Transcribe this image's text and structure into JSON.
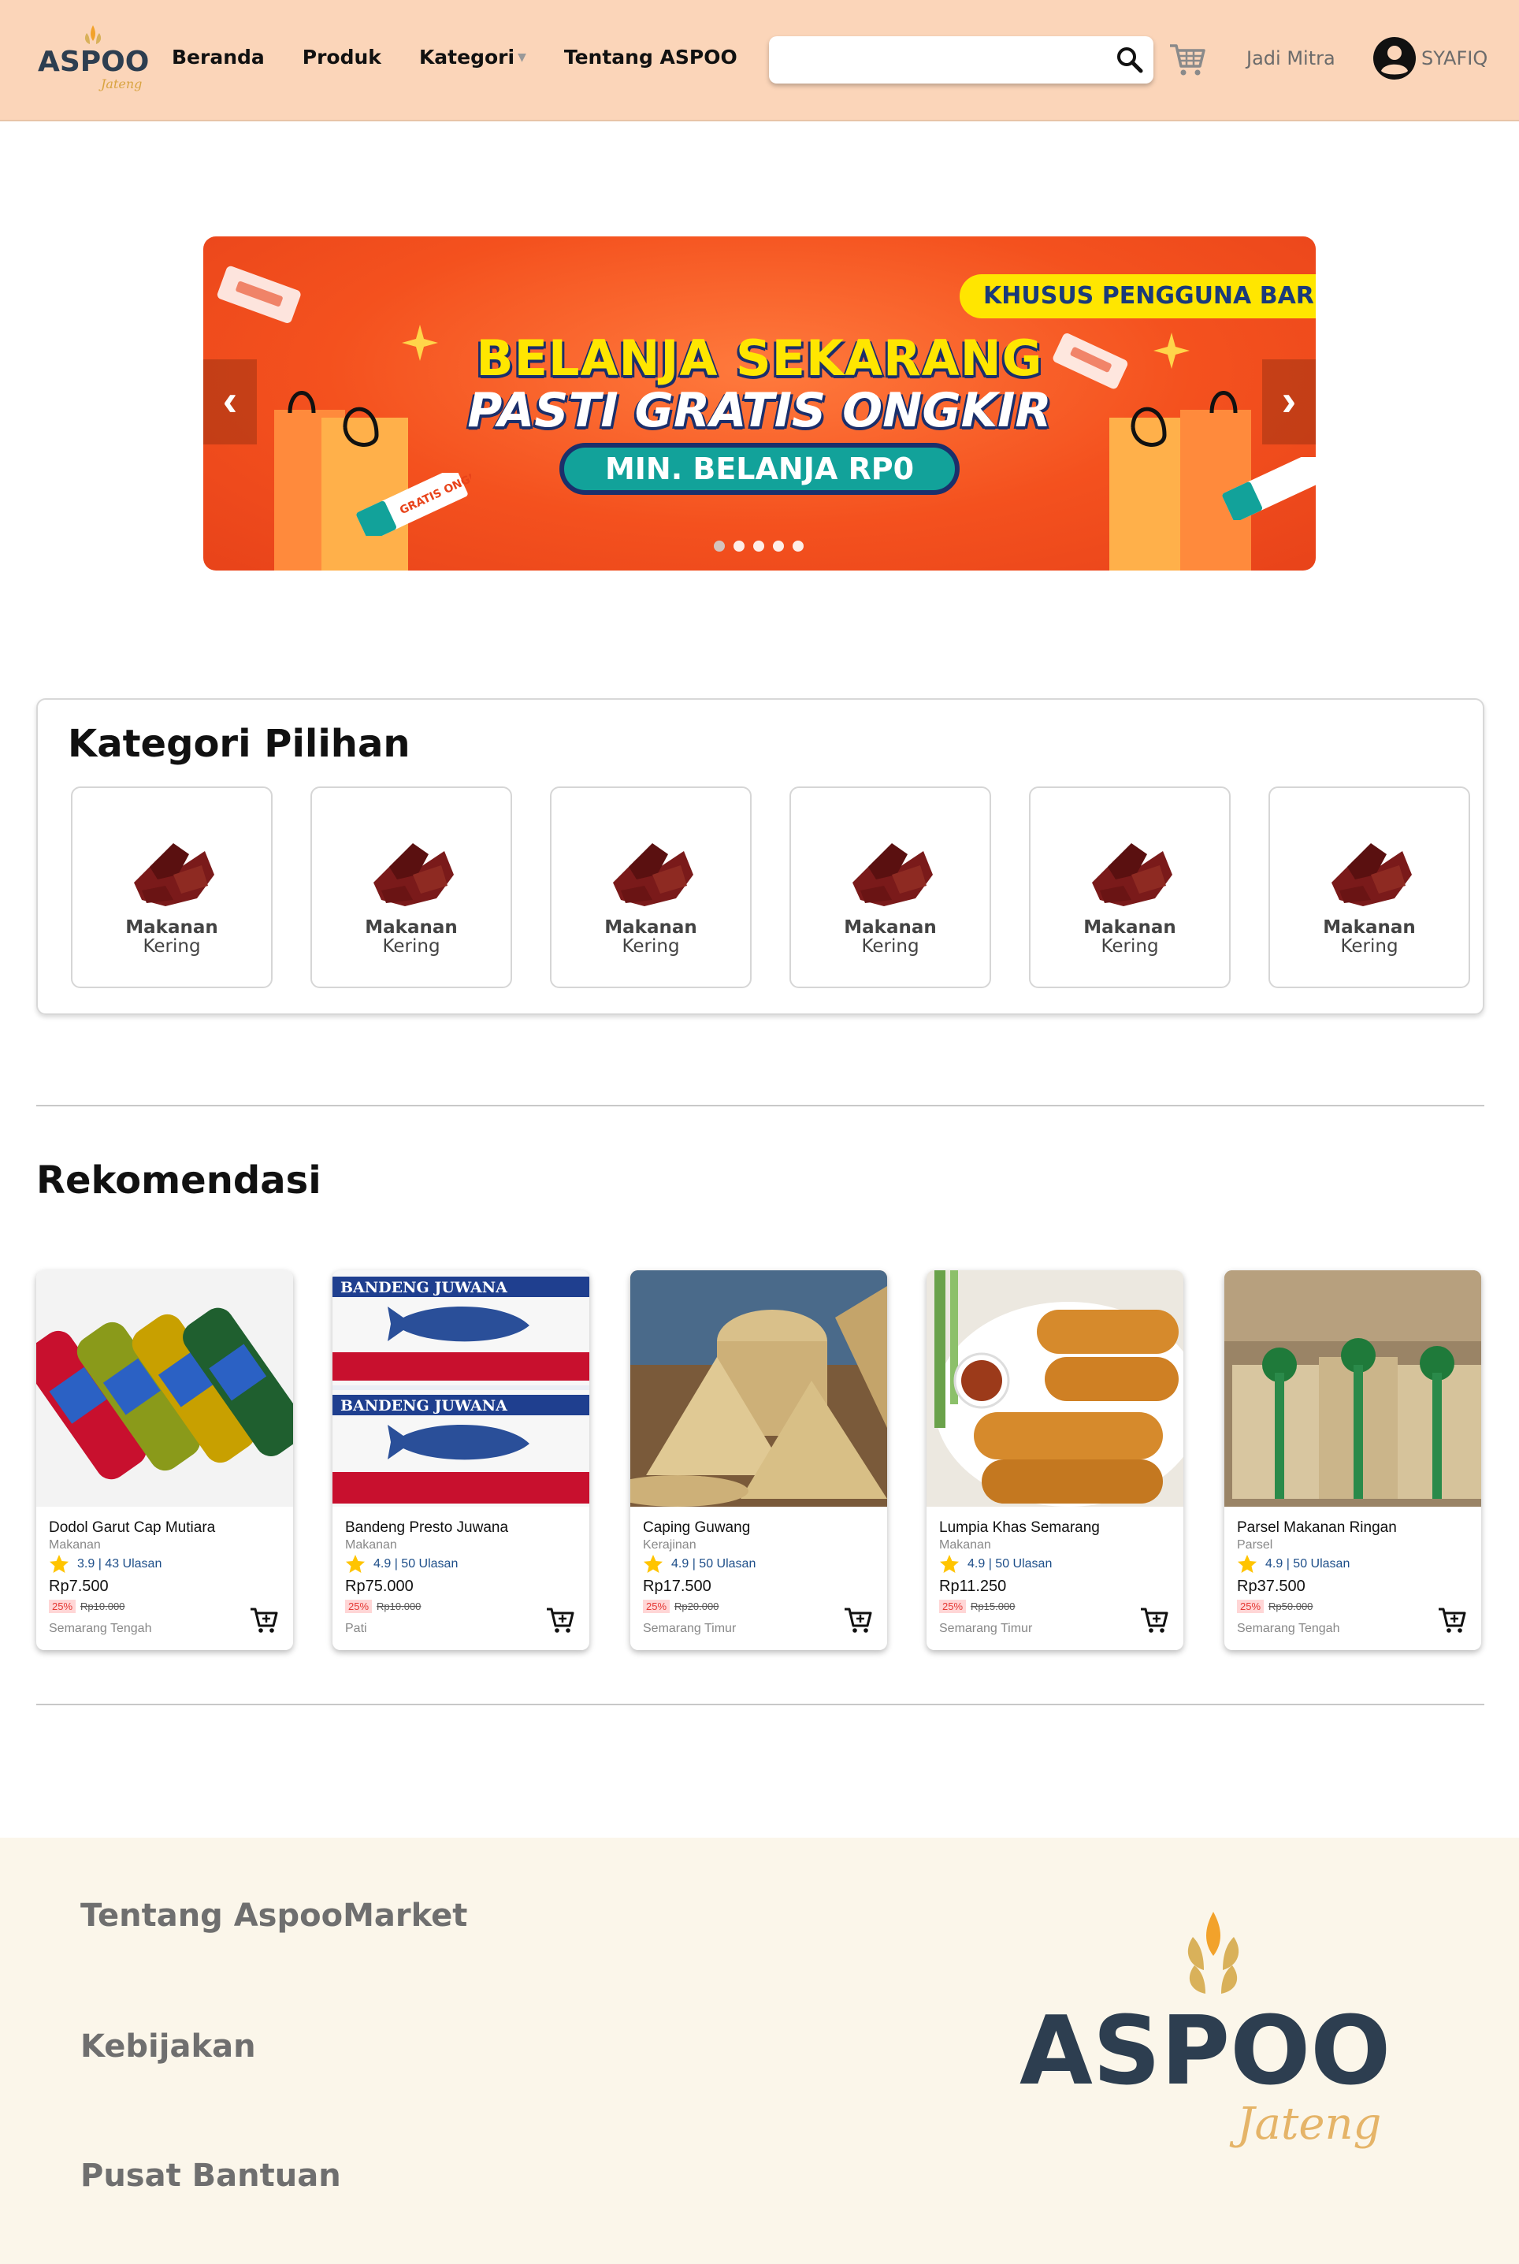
{
  "header": {
    "logo_text": "ASPOO",
    "logo_sub": "Jateng",
    "nav": [
      {
        "label": "Beranda"
      },
      {
        "label": "Produk"
      },
      {
        "label": "Kategori"
      },
      {
        "label": "Tentang ASPOO"
      }
    ],
    "search_placeholder": "",
    "mitra_label": "Jadi Mitra",
    "user_name": "SYAFIQ"
  },
  "banner": {
    "tag": "KHUSUS PENGGUNA BARU",
    "line1": "BELANJA SEKARANG",
    "line2": "PASTI GRATIS ONGKIR",
    "pill": "MIN. BELANJA RP0",
    "sticker": "GRATIS ONGKIR",
    "prev": "‹",
    "next": "›",
    "slides": 5,
    "active_slide": 0,
    "colors": {
      "bg": "#f4511e",
      "yellow": "#ffe600",
      "navy": "#1b2f6b",
      "teal": "#12a29a"
    }
  },
  "kategori": {
    "title": "Kategori Pilihan",
    "items": [
      {
        "line1": "Makanan",
        "line2": "Kering"
      },
      {
        "line1": "Makanan",
        "line2": "Kering"
      },
      {
        "line1": "Makanan",
        "line2": "Kering"
      },
      {
        "line1": "Makanan",
        "line2": "Kering"
      },
      {
        "line1": "Makanan",
        "line2": "Kering"
      },
      {
        "line1": "Makanan",
        "line2": "Kering"
      }
    ]
  },
  "rekomendasi": {
    "title": "Rekomendasi",
    "products": [
      {
        "name": "Dodol Garut Cap Mutiara",
        "category": "Makanan",
        "rating": "3.9 | 43 Ulasan",
        "price": "Rp7.500",
        "discount": "25%",
        "old_price": "Rp10.000",
        "location": "Semarang Tengah"
      },
      {
        "name": "Bandeng Presto Juwana",
        "category": "Makanan",
        "rating": "4.9 | 50 Ulasan",
        "price": "Rp75.000",
        "discount": "25%",
        "old_price": "Rp10.000",
        "location": "Pati",
        "image_text": "BANDENG JUWANA"
      },
      {
        "name": "Caping Guwang",
        "category": "Kerajinan",
        "rating": "4.9 | 50 Ulasan",
        "price": "Rp17.500",
        "discount": "25%",
        "old_price": "Rp20.000",
        "location": "Semarang Timur"
      },
      {
        "name": "Lumpia Khas Semarang",
        "category": "Makanan",
        "rating": "4.9 | 50 Ulasan",
        "price": "Rp11.250",
        "discount": "25%",
        "old_price": "Rp15.000",
        "location": "Semarang Timur"
      },
      {
        "name": "Parsel Makanan Ringan",
        "category": "Parsel",
        "rating": "4.9 | 50 Ulasan",
        "price": "Rp37.500",
        "discount": "25%",
        "old_price": "Rp50.000",
        "location": "Semarang Tengah"
      }
    ]
  },
  "footer": {
    "links": [
      "Tentang AspooMarket",
      "Kebijakan",
      "Pusat Bantuan"
    ],
    "logo_text": "ASPOO",
    "logo_sub": "Jateng"
  }
}
